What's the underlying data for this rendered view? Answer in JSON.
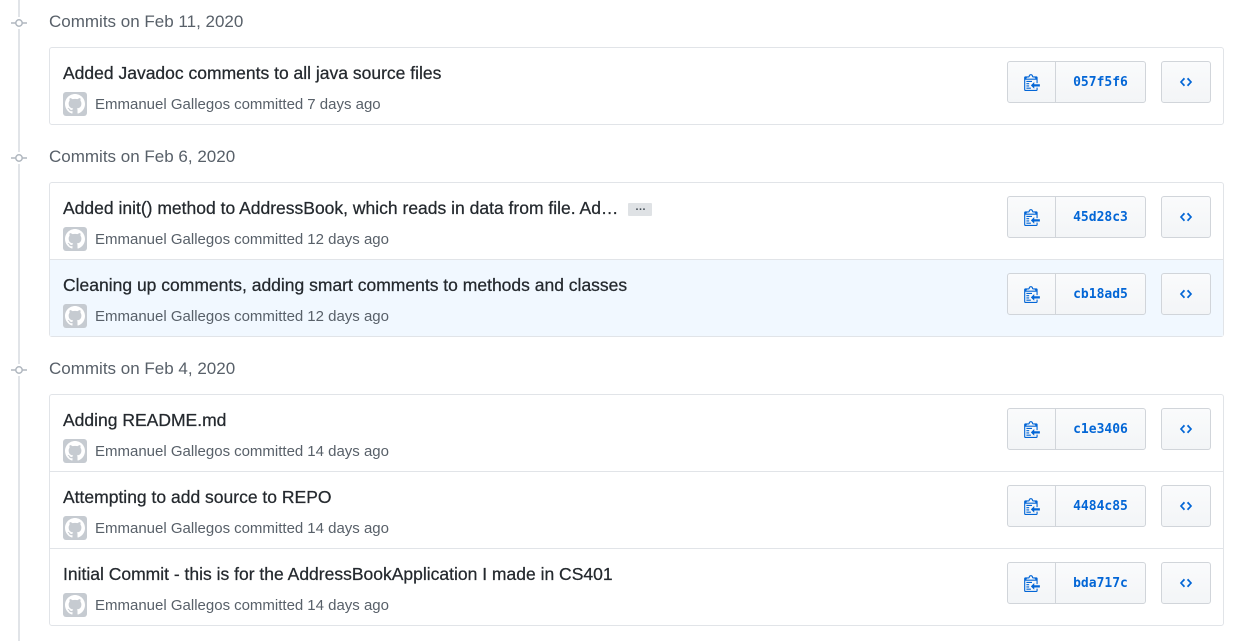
{
  "colors": {
    "link": "#0366d6",
    "muted": "#586069",
    "border": "#e1e4e8",
    "highlight_row": "#f1f8ff"
  },
  "icons": {
    "node": "git-commit-icon",
    "copy": "clippy-icon",
    "browse": "code-icon",
    "avatar": "github-avatar"
  },
  "groups": [
    {
      "title": "Commits on Feb 11, 2020",
      "commits": [
        {
          "message": "Added Javadoc comments to all java source files",
          "author": "Emmanuel Gallegos",
          "action": "committed",
          "when": "7 days ago",
          "sha": "057f5f6",
          "truncated": false,
          "highlighted": false
        }
      ]
    },
    {
      "title": "Commits on Feb 6, 2020",
      "commits": [
        {
          "message": "Added init() method to AddressBook, which reads in data from file. Ad…",
          "author": "Emmanuel Gallegos",
          "action": "committed",
          "when": "12 days ago",
          "sha": "45d28c3",
          "truncated": true,
          "ellipsis_label": "…",
          "highlighted": false
        },
        {
          "message": "Cleaning up comments, adding smart comments to methods and classes",
          "author": "Emmanuel Gallegos",
          "action": "committed",
          "when": "12 days ago",
          "sha": "cb18ad5",
          "truncated": false,
          "highlighted": true
        }
      ]
    },
    {
      "title": "Commits on Feb 4, 2020",
      "commits": [
        {
          "message": "Adding README.md",
          "author": "Emmanuel Gallegos",
          "action": "committed",
          "when": "14 days ago",
          "sha": "c1e3406",
          "truncated": false,
          "highlighted": false
        },
        {
          "message": "Attempting to add source to REPO",
          "author": "Emmanuel Gallegos",
          "action": "committed",
          "when": "14 days ago",
          "sha": "4484c85",
          "truncated": false,
          "highlighted": false
        },
        {
          "message": "Initial Commit - this is for the AddressBookApplication I made in CS401",
          "author": "Emmanuel Gallegos",
          "action": "committed",
          "when": "14 days ago",
          "sha": "bda717c",
          "truncated": false,
          "highlighted": false
        }
      ]
    }
  ]
}
